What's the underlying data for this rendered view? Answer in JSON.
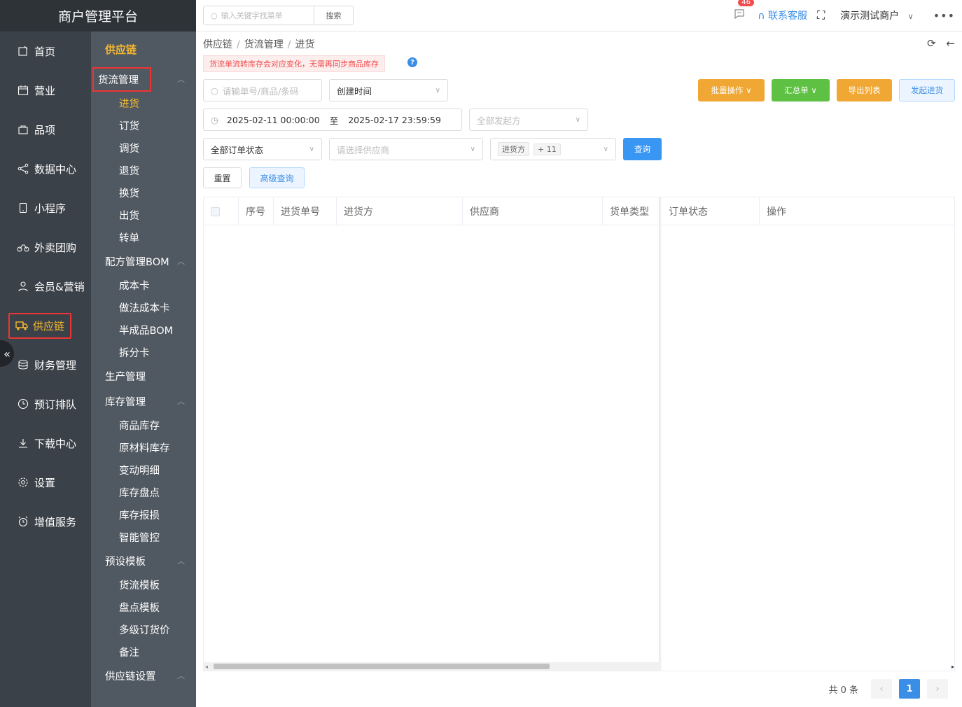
{
  "brand": "商户管理平台",
  "topbar": {
    "search_placeholder": "输入关键字找菜单",
    "search_btn": "搜索",
    "msg_count": "46",
    "contact": "联系客服",
    "merchant": "演示测试商户"
  },
  "main_nav": [
    {
      "label": "首页",
      "icon": "home-icon"
    },
    {
      "label": "营业",
      "icon": "calendar-icon"
    },
    {
      "label": "品项",
      "icon": "bag-icon"
    },
    {
      "label": "数据中心",
      "icon": "share-icon"
    },
    {
      "label": "小程序",
      "icon": "phone-icon"
    },
    {
      "label": "外卖团购",
      "icon": "bike-icon"
    },
    {
      "label": "会员&营销",
      "icon": "user-icon"
    },
    {
      "label": "供应链",
      "icon": "truck-icon",
      "active": true
    },
    {
      "label": "财务管理",
      "icon": "database-icon"
    },
    {
      "label": "预订排队",
      "icon": "clock-icon"
    },
    {
      "label": "下载中心",
      "icon": "download-icon"
    },
    {
      "label": "设置",
      "icon": "gear-icon"
    },
    {
      "label": "增值服务",
      "icon": "alarm-icon"
    }
  ],
  "sub_nav": {
    "title": "供应链",
    "groups": [
      {
        "label": "货流管理",
        "boxed": true,
        "items": [
          "进货",
          "订货",
          "调货",
          "退货",
          "换货",
          "出货",
          "转单"
        ]
      },
      {
        "label": "配方管理BOM",
        "items": [
          "成本卡",
          "做法成本卡",
          "半成品BOM",
          "拆分卡"
        ]
      },
      {
        "label": "生产管理",
        "items": [],
        "no_chevron": true
      },
      {
        "label": "库存管理",
        "items": [
          "商品库存",
          "原材料库存",
          "变动明细",
          "库存盘点",
          "库存报损",
          "智能管控"
        ]
      },
      {
        "label": "预设模板",
        "items": [
          "货流模板",
          "盘点模板",
          "多级订货价",
          "备注"
        ]
      },
      {
        "label": "供应链设置",
        "items": []
      }
    ]
  },
  "breadcrumb": [
    "供应链",
    "货流管理",
    "进货"
  ],
  "notice": "货流单流转库存会对应变化，无需再同步商品库存",
  "filters": {
    "search_placeholder": "请输单号/商品/条码",
    "time_type": "创建时间",
    "date_start": "2025-02-11 00:00:00",
    "date_sep": "至",
    "date_end": "2025-02-17 23:59:59",
    "initiator": "全部发起方",
    "order_status": "全部订单状态",
    "supplier_placeholder": "请选择供应商",
    "receiver_tag": "进货方",
    "receiver_more": "+ 11",
    "query": "查询",
    "reset": "重置",
    "advanced": "高级查询"
  },
  "actions": {
    "batch": "批量操作",
    "summary": "汇总单",
    "export": "导出列表",
    "create": "发起进货"
  },
  "table": {
    "headers": [
      "序号",
      "进货单号",
      "进货方",
      "供应商",
      "货单类型",
      "订单状态",
      "操作"
    ]
  },
  "pager": {
    "total": "共 0 条",
    "current": "1"
  }
}
